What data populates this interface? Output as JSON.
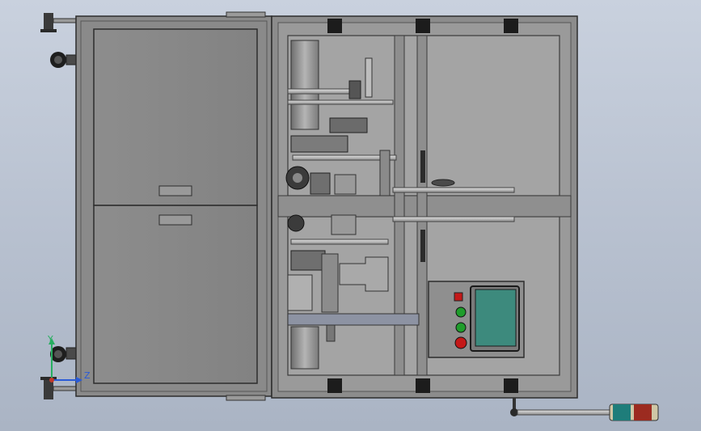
{
  "viewport": {
    "background_top": "#c9d1de",
    "background_bottom": "#aab4c4"
  },
  "colors": {
    "frame": "#7a7a7a",
    "frame_dark": "#3c3c3c",
    "panel": "#8b8b8b",
    "inner": "#a0a0a0",
    "screen": "#3d8a7d",
    "lamp_red": "#c41818",
    "lamp_green": "#1f9d2b",
    "tower_green": "#1e7d7a",
    "tower_red": "#9c2b20",
    "axis_x": "#c0392b",
    "axis_y": "#27ae60",
    "axis_z": "#2a5bd7"
  },
  "axes": {
    "y_label": "Y",
    "z_label": "Z"
  },
  "icons": [
    "leveling-foot-icon",
    "caster-wheel-icon",
    "corner-bracket-icon",
    "signal-tower-icon",
    "triad-axes-icon"
  ]
}
